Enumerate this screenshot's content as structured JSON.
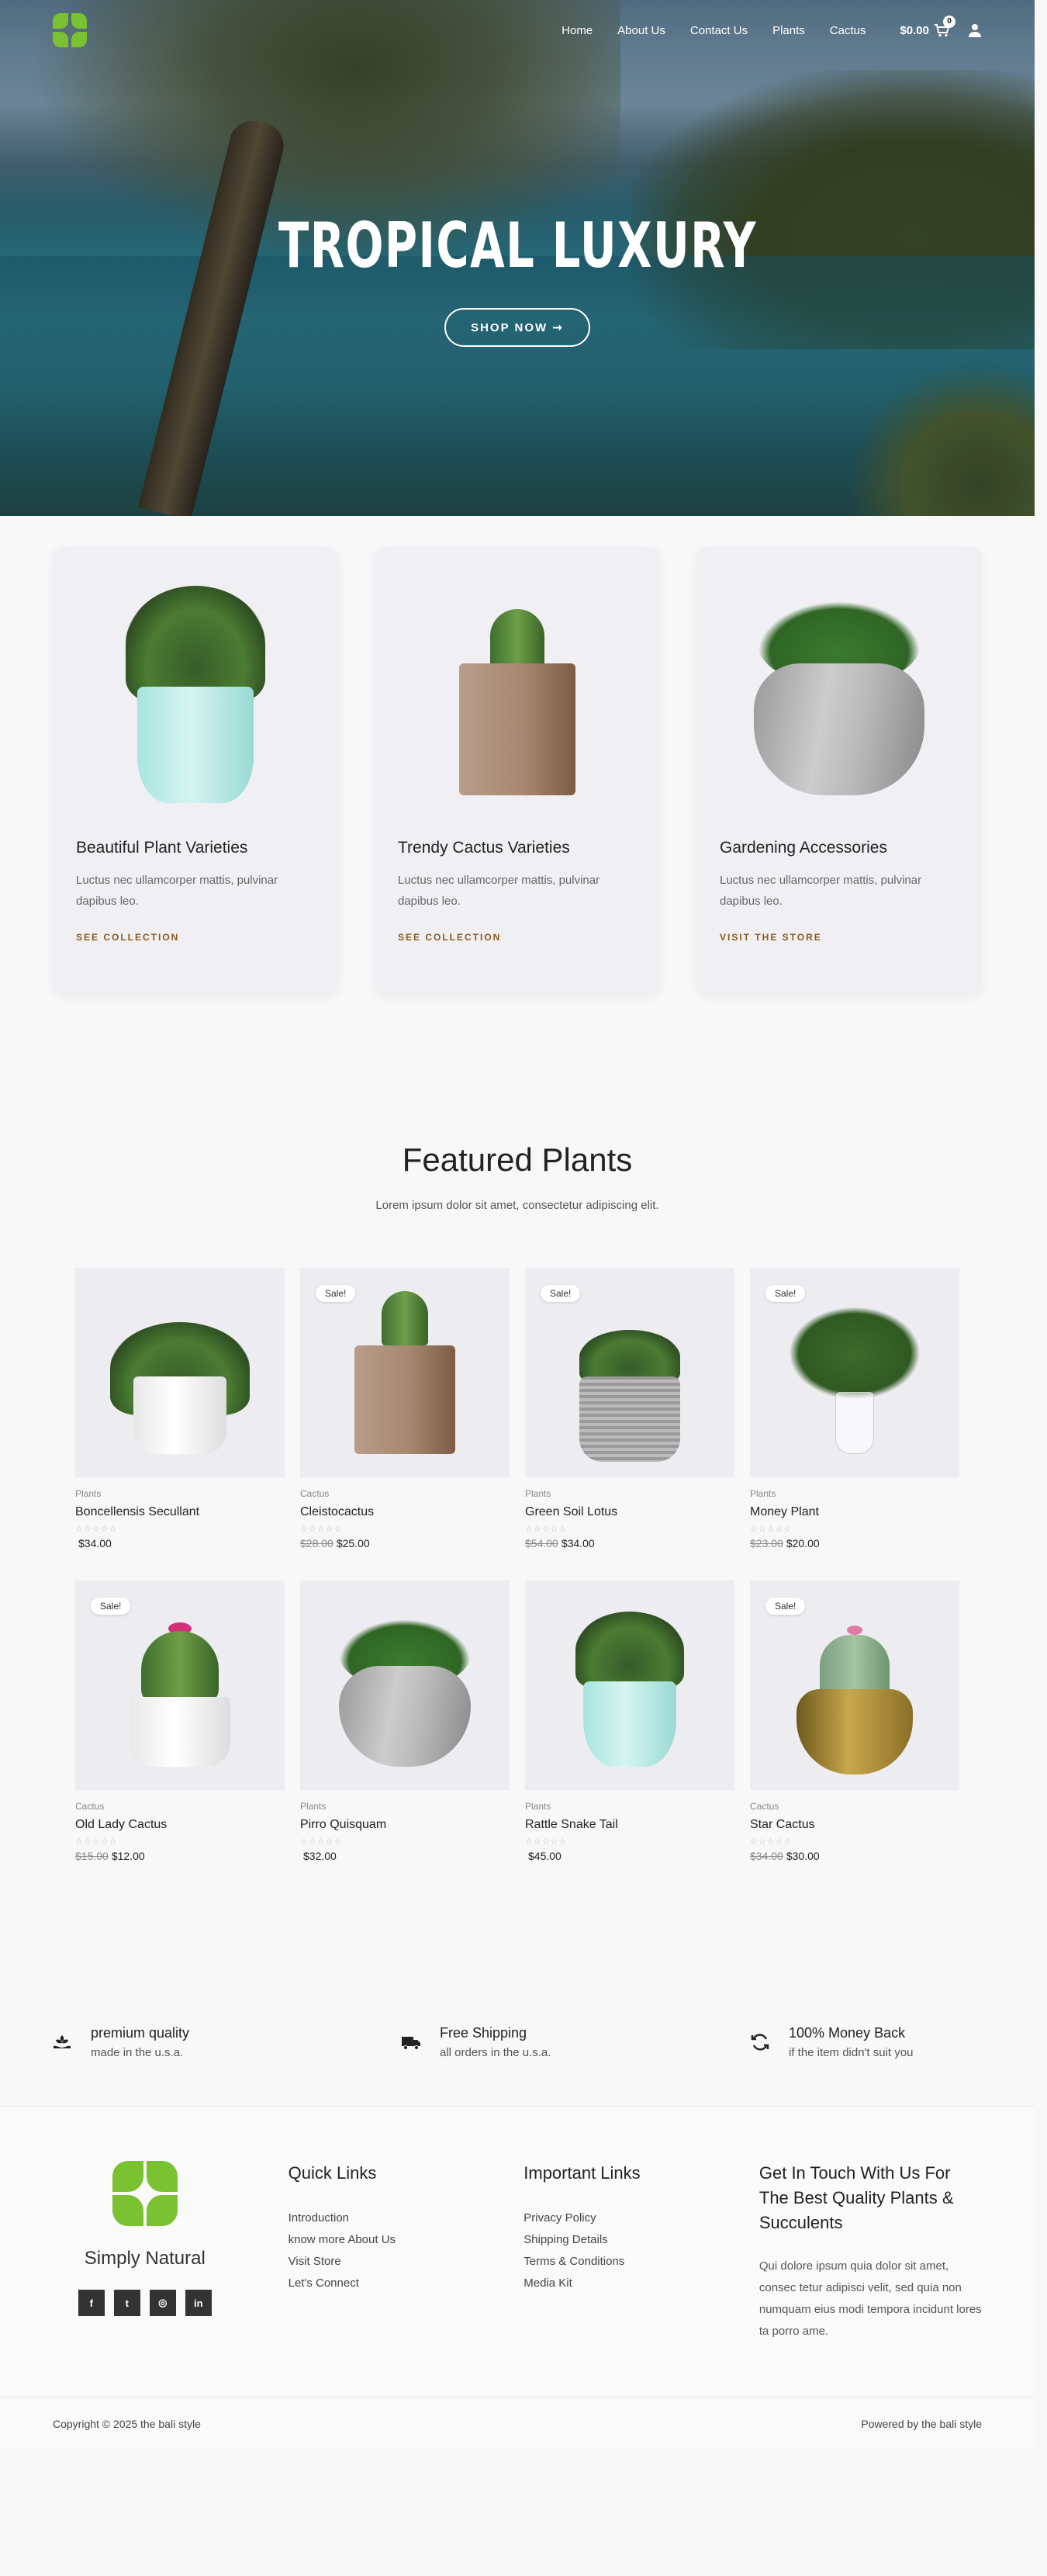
{
  "nav": {
    "links": [
      "Home",
      "About Us",
      "Contact Us",
      "Plants",
      "Cactus"
    ],
    "cart_total": "$0.00",
    "cart_count": "0"
  },
  "hero": {
    "title": "TROPICAL LUXURY",
    "button": "SHOP NOW ➞"
  },
  "collections": [
    {
      "title": "Beautiful Plant Varieties",
      "desc": "Luctus nec ullamcorper mattis, pulvinar dapibus leo.",
      "link": "SEE COLLECTION"
    },
    {
      "title": "Trendy Cactus Varieties",
      "desc": "Luctus nec ullamcorper mattis, pulvinar dapibus leo.",
      "link": "SEE COLLECTION"
    },
    {
      "title": "Gardening Accessories",
      "desc": "Luctus nec ullamcorper mattis, pulvinar dapibus leo.",
      "link": "VISIT THE STORE"
    }
  ],
  "featured": {
    "title": "Featured Plants",
    "subtitle": "Lorem ipsum dolor sit amet, consectetur adipiscing elit.",
    "sale_label": "Sale!",
    "stars": "☆☆☆☆☆",
    "products": [
      {
        "category": "Plants",
        "name": "Boncellensis Secullant",
        "old_price": "",
        "price": "$34.00",
        "sale": false
      },
      {
        "category": "Cactus",
        "name": "Cleistocactus",
        "old_price": "$28.00",
        "price": "$25.00",
        "sale": true
      },
      {
        "category": "Plants",
        "name": "Green Soil Lotus",
        "old_price": "$54.00",
        "price": "$34.00",
        "sale": true
      },
      {
        "category": "Plants",
        "name": "Money Plant",
        "old_price": "$23.00",
        "price": "$20.00",
        "sale": true
      },
      {
        "category": "Cactus",
        "name": "Old Lady Cactus",
        "old_price": "$15.00",
        "price": "$12.00",
        "sale": true
      },
      {
        "category": "Plants",
        "name": "Pirro Quisquam",
        "old_price": "",
        "price": "$32.00",
        "sale": false
      },
      {
        "category": "Plants",
        "name": "Rattle Snake Tail",
        "old_price": "",
        "price": "$45.00",
        "sale": false
      },
      {
        "category": "Cactus",
        "name": "Star Cactus",
        "old_price": "$34.00",
        "price": "$30.00",
        "sale": true
      }
    ]
  },
  "features": [
    {
      "icon": "plant-hand-icon",
      "title": "premium quality",
      "sub": "made in the u.s.a."
    },
    {
      "icon": "truck-icon",
      "title": "Free Shipping",
      "sub": "all orders in the u.s.a."
    },
    {
      "icon": "refresh-icon",
      "title": "100% Money Back",
      "sub": "if the item didn't suit you"
    }
  ],
  "footer": {
    "brand": "Simply Natural",
    "socials": [
      "f",
      "t",
      "◎",
      "in"
    ],
    "quick_links_heading": "Quick Links",
    "quick_links": [
      "Introduction",
      "know more About Us",
      "Visit Store",
      "Let's Connect"
    ],
    "important_links_heading": "Important Links",
    "important_links": [
      "Privacy Policy",
      "Shipping Details",
      "Terms & Conditions",
      "Media Kit"
    ],
    "contact_heading": "Get In Touch With Us For The Best Quality Plants & Succulents",
    "contact_text": "Qui dolore ipsum quia dolor sit amet, consec tetur adipisci velit, sed quia non numquam eius modi tempora incidunt lores ta porro ame.",
    "copyright": "Copyright © 2025 the bali style",
    "powered": "Powered by the bali style"
  },
  "colors": {
    "brand_green": "#7ac231",
    "link_brown": "#8a5a1c"
  }
}
